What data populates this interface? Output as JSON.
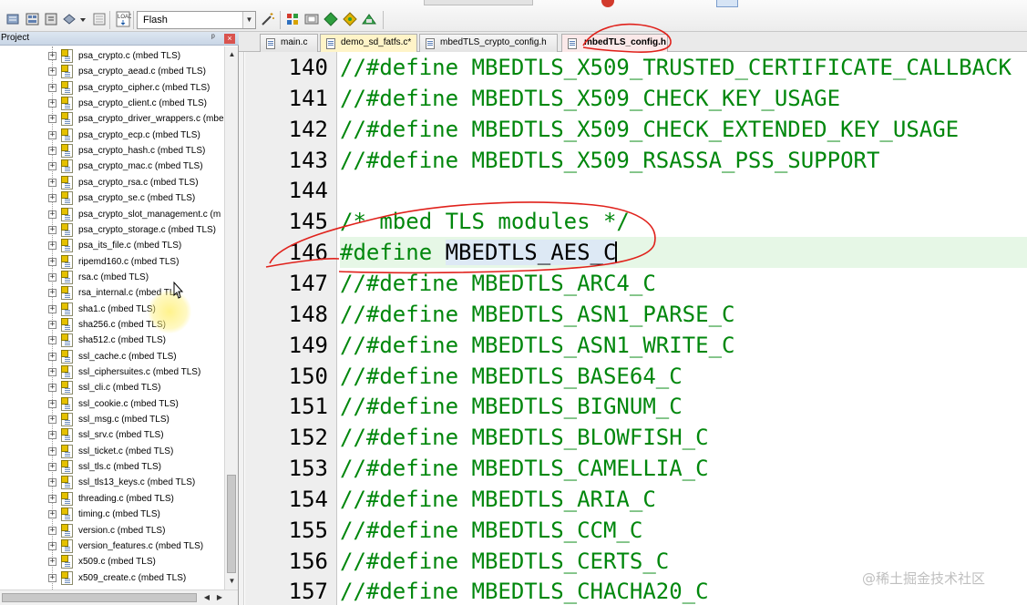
{
  "toolbar": {
    "target_value": "Flash",
    "icons": [
      "build-icon",
      "batch-build-icon",
      "download-icon",
      "dropdown-arrow-icon",
      "translate-icon",
      "load-icon",
      "target-options-icon",
      "manage-components-icon",
      "pack-installer-icon",
      "select-packs-icon",
      "run-time-environment-icon",
      "debug-icon"
    ]
  },
  "project_panel": {
    "title": "Project",
    "pin_glyph": "ᵖ",
    "close_glyph": "×",
    "files": [
      "psa_crypto.c (mbed TLS)",
      "psa_crypto_aead.c (mbed TLS)",
      "psa_crypto_cipher.c (mbed TLS)",
      "psa_crypto_client.c (mbed TLS)",
      "psa_crypto_driver_wrappers.c (mbe",
      "psa_crypto_ecp.c (mbed TLS)",
      "psa_crypto_hash.c (mbed TLS)",
      "psa_crypto_mac.c (mbed TLS)",
      "psa_crypto_rsa.c (mbed TLS)",
      "psa_crypto_se.c (mbed TLS)",
      "psa_crypto_slot_management.c (m",
      "psa_crypto_storage.c (mbed TLS)",
      "psa_its_file.c (mbed TLS)",
      "ripemd160.c (mbed TLS)",
      "rsa.c (mbed TLS)",
      "rsa_internal.c (mbed TLS",
      "sha1.c (mbed TLS)",
      "sha256.c (mbed TLS)",
      "sha512.c (mbed TLS)",
      "ssl_cache.c (mbed TLS)",
      "ssl_ciphersuites.c (mbed TLS)",
      "ssl_cli.c (mbed TLS)",
      "ssl_cookie.c (mbed TLS)",
      "ssl_msg.c (mbed TLS)",
      "ssl_srv.c (mbed TLS)",
      "ssl_ticket.c (mbed TLS)",
      "ssl_tls.c (mbed TLS)",
      "ssl_tls13_keys.c (mbed TLS)",
      "threading.c (mbed TLS)",
      "timing.c (mbed TLS)",
      "version.c (mbed TLS)",
      "version_features.c (mbed TLS)",
      "x509.c (mbed TLS)",
      "x509_create.c (mbed TLS)"
    ],
    "expand_glyph": "+"
  },
  "tabs": [
    {
      "label": "main.c",
      "active": false
    },
    {
      "label": "demo_sd_fatfs.c*",
      "active": false
    },
    {
      "label": "mbedTLS_crypto_config.h",
      "active": false
    },
    {
      "label": "mbedTLS_config.h",
      "active": true
    }
  ],
  "editor": {
    "lines": [
      {
        "num": "140",
        "text": "//#define MBEDTLS_X509_TRUSTED_CERTIFICATE_CALLBACK",
        "kind": "comment"
      },
      {
        "num": "141",
        "text": "//#define MBEDTLS_X509_CHECK_KEY_USAGE",
        "kind": "comment"
      },
      {
        "num": "142",
        "text": "//#define MBEDTLS_X509_CHECK_EXTENDED_KEY_USAGE",
        "kind": "comment"
      },
      {
        "num": "143",
        "text": "//#define MBEDTLS_X509_RSASSA_PSS_SUPPORT",
        "kind": "comment"
      },
      {
        "num": "144",
        "text": "",
        "kind": "blank"
      },
      {
        "num": "145",
        "text": "/* mbed TLS modules */",
        "kind": "comment"
      },
      {
        "num": "146",
        "directive": "#define",
        "ident": "MBEDTLS_AES_C",
        "kind": "define"
      },
      {
        "num": "147",
        "text": "//#define MBEDTLS_ARC4_C",
        "kind": "comment"
      },
      {
        "num": "148",
        "text": "//#define MBEDTLS_ASN1_PARSE_C",
        "kind": "comment"
      },
      {
        "num": "149",
        "text": "//#define MBEDTLS_ASN1_WRITE_C",
        "kind": "comment"
      },
      {
        "num": "150",
        "text": "//#define MBEDTLS_BASE64_C",
        "kind": "comment"
      },
      {
        "num": "151",
        "text": "//#define MBEDTLS_BIGNUM_C",
        "kind": "comment"
      },
      {
        "num": "152",
        "text": "//#define MBEDTLS_BLOWFISH_C",
        "kind": "comment"
      },
      {
        "num": "153",
        "text": "//#define MBEDTLS_CAMELLIA_C",
        "kind": "comment"
      },
      {
        "num": "154",
        "text": "//#define MBEDTLS_ARIA_C",
        "kind": "comment"
      },
      {
        "num": "155",
        "text": "//#define MBEDTLS_CCM_C",
        "kind": "comment"
      },
      {
        "num": "156",
        "text": "//#define MBEDTLS_CERTS_C",
        "kind": "comment"
      },
      {
        "num": "157",
        "text": "//#define MBEDTLS_CHACHA20_C",
        "kind": "comment"
      }
    ],
    "current_line": "146"
  },
  "colors": {
    "comment": "#00870c",
    "current_line_bg": "#e6f7e6",
    "annotation": "#e0211b",
    "active_tab_bg": "#fbe9e9"
  },
  "watermark": "@稀土掘金技术社区"
}
